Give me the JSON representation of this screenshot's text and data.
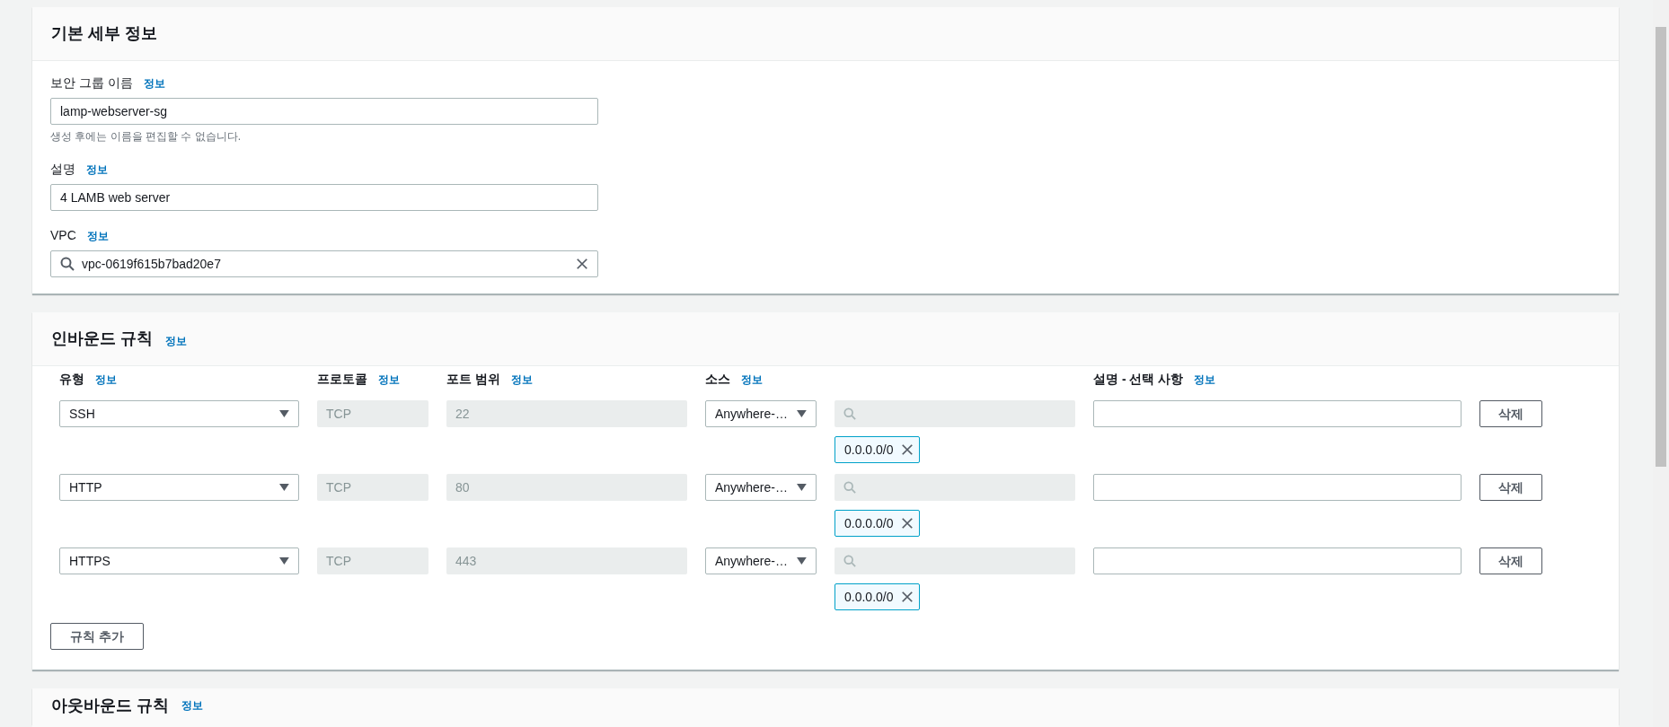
{
  "basic_details": {
    "title": "기본 세부 정보",
    "fields": [
      {
        "kind": "text",
        "label": "보안 그룹 이름",
        "info": "정보",
        "value": "lamp-webserver-sg",
        "hint": "생성 후에는 이름을 편집할 수 없습니다."
      },
      {
        "kind": "text",
        "label": "설명",
        "info": "정보",
        "value": "4 LAMB web server"
      },
      {
        "kind": "search",
        "label": "VPC",
        "info": "정보",
        "value": "vpc-0619f615b7bad20e7"
      }
    ]
  },
  "inbound_rules": {
    "title": "인바운드 규칙",
    "info": "정보",
    "columns": [
      {
        "label": "유형",
        "info": "정보"
      },
      {
        "label": "프로토콜",
        "info": "정보"
      },
      {
        "label": "포트 범위",
        "info": "정보"
      },
      {
        "label": "소스",
        "info": "정보"
      },
      {
        "label": "설명 - 선택 사항",
        "info": "정보"
      }
    ],
    "rows": [
      {
        "type": "SSH",
        "protocol": "TCP",
        "port_range": "22",
        "source": "Anywhere-…",
        "source_tags": [
          "0.0.0.0/0"
        ],
        "delete_button": "삭제"
      },
      {
        "type": "HTTP",
        "protocol": "TCP",
        "port_range": "80",
        "source": "Anywhere-…",
        "source_tags": [
          "0.0.0.0/0"
        ],
        "delete_button": "삭제"
      },
      {
        "type": "HTTPS",
        "protocol": "TCP",
        "port_range": "443",
        "source": "Anywhere-…",
        "source_tags": [
          "0.0.0.0/0"
        ],
        "delete_button": "삭제"
      }
    ],
    "add_button": "규칙 추가"
  },
  "outbound_rules": {
    "title": "아웃바운드 규칙",
    "info": "정보"
  }
}
